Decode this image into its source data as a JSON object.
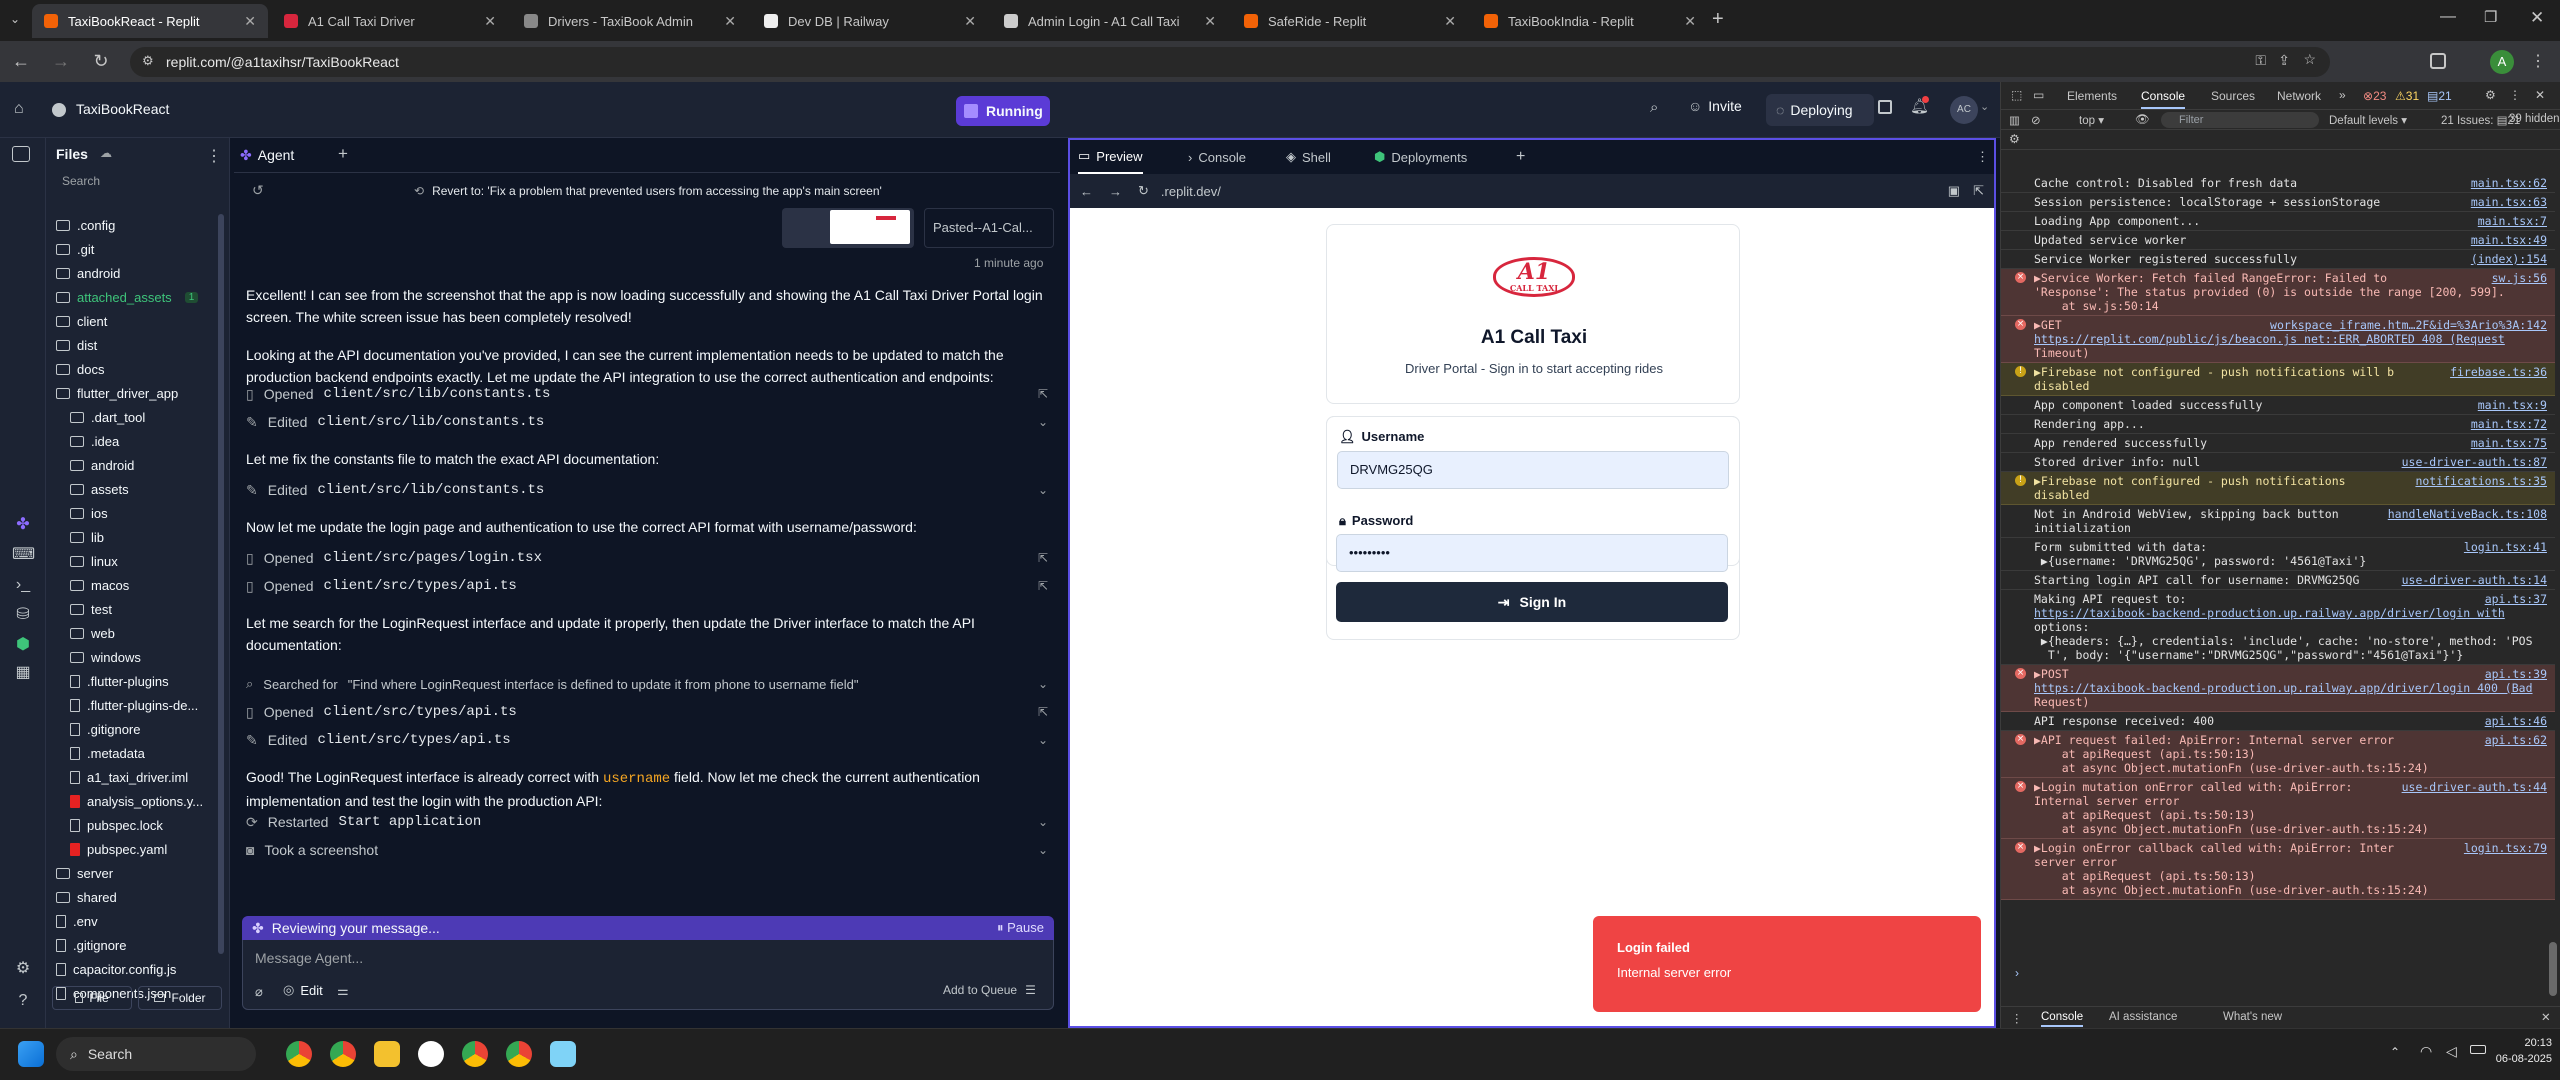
{
  "browser": {
    "tabs": [
      {
        "title": "TaxiBookReact - Replit",
        "color": "#f26207"
      },
      {
        "title": "A1 Call Taxi Driver",
        "color": "#d7263d"
      },
      {
        "title": "Drivers - TaxiBook Admin",
        "color": "#888888"
      },
      {
        "title": "Dev DB | Railway",
        "color": "#eeeeee"
      },
      {
        "title": "Admin Login - A1 Call Taxi",
        "color": "#cccccc"
      },
      {
        "title": "SafeRide - Replit",
        "color": "#f26207"
      },
      {
        "title": "TaxiBookIndia - Replit",
        "color": "#f26207"
      }
    ],
    "url": "replit.com/@a1taxihsr/TaxiBookReact",
    "profile_initial": "A"
  },
  "replit": {
    "project_name": "TaxiBookReact",
    "run_label": "Running",
    "invite_label": "Invite",
    "deploying_label": "Deploying",
    "avatar": "AC",
    "files_title": "Files",
    "search_placeholder": "Search",
    "file_button": "File",
    "folder_button": "Folder",
    "badge_count": "1",
    "files": [
      {
        "name": ".config",
        "kind": "folder",
        "indent": 0
      },
      {
        "name": ".git",
        "kind": "folder",
        "indent": 0
      },
      {
        "name": "android",
        "kind": "folder",
        "indent": 0
      },
      {
        "name": "attached_assets",
        "kind": "folder",
        "indent": 0,
        "highlight": true
      },
      {
        "name": "client",
        "kind": "folder",
        "indent": 0
      },
      {
        "name": "dist",
        "kind": "folder",
        "indent": 0
      },
      {
        "name": "docs",
        "kind": "folder",
        "indent": 0
      },
      {
        "name": "flutter_driver_app",
        "kind": "folder",
        "indent": 0
      },
      {
        "name": ".dart_tool",
        "kind": "folder",
        "indent": 1
      },
      {
        "name": ".idea",
        "kind": "folder",
        "indent": 1
      },
      {
        "name": "android",
        "kind": "folder",
        "indent": 1
      },
      {
        "name": "assets",
        "kind": "folder",
        "indent": 1
      },
      {
        "name": "ios",
        "kind": "folder",
        "indent": 1
      },
      {
        "name": "lib",
        "kind": "folder",
        "indent": 1
      },
      {
        "name": "linux",
        "kind": "folder",
        "indent": 1
      },
      {
        "name": "macos",
        "kind": "folder",
        "indent": 1
      },
      {
        "name": "test",
        "kind": "folder",
        "indent": 1
      },
      {
        "name": "web",
        "kind": "folder",
        "indent": 1
      },
      {
        "name": "windows",
        "kind": "folder",
        "indent": 1
      },
      {
        "name": ".flutter-plugins",
        "kind": "file",
        "indent": 1
      },
      {
        "name": ".flutter-plugins-de...",
        "kind": "file",
        "indent": 1
      },
      {
        "name": ".gitignore",
        "kind": "file",
        "indent": 1
      },
      {
        "name": ".metadata",
        "kind": "file",
        "indent": 1
      },
      {
        "name": "a1_taxi_driver.iml",
        "kind": "file",
        "indent": 1
      },
      {
        "name": "analysis_options.y...",
        "kind": "red",
        "indent": 1
      },
      {
        "name": "pubspec.lock",
        "kind": "file",
        "indent": 1
      },
      {
        "name": "pubspec.yaml",
        "kind": "red",
        "indent": 1
      },
      {
        "name": "server",
        "kind": "folder",
        "indent": 0
      },
      {
        "name": "shared",
        "kind": "folder",
        "indent": 0
      },
      {
        "name": ".env",
        "kind": "file",
        "indent": 0
      },
      {
        "name": ".gitignore",
        "kind": "file",
        "indent": 0
      },
      {
        "name": "capacitor.config.js",
        "kind": "file",
        "indent": 0
      },
      {
        "name": "components.json",
        "kind": "file",
        "indent": 0
      }
    ]
  },
  "agent": {
    "tab_label": "Agent",
    "revert_text": "Revert to: 'Fix a problem that prevented users from accessing the app's main screen'",
    "pasted_label": "Pasted--A1-Cal...",
    "time_ago": "1 minute ago",
    "messages": [
      "Excellent! I can see from the screenshot that the app is now loading successfully and showing the A1 Call Taxi Driver Portal login screen. The white screen issue has been completely resolved!",
      "Looking at the API documentation you've provided, I can see the current implementation needs to be updated to match the production backend endpoints exactly. Let me update the API integration to use the correct authentication and endpoints:",
      "Let me fix the constants file to match the exact API documentation:",
      "Now let me update the login page and authentication to use the correct API format with username/password:",
      "Let me search for the LoginRequest interface and update it properly, then update the Driver interface to match the API documentation:"
    ],
    "msg_good_a": "Good! The LoginRequest interface is already correct with ",
    "msg_good_code": "username",
    "msg_good_b": " field. Now let me check the current authentication implementation and test the login with the production API:",
    "actions": [
      {
        "verb": "Opened",
        "path": "client/src/lib/constants.ts"
      },
      {
        "verb": "Edited",
        "path": "client/src/lib/constants.ts"
      },
      {
        "verb": "Edited",
        "path": "client/src/lib/constants.ts"
      },
      {
        "verb": "Opened",
        "path": "client/src/pages/login.tsx"
      },
      {
        "verb": "Opened",
        "path": "client/src/types/api.ts"
      },
      {
        "verb": "Searched for",
        "path": "\"Find where LoginRequest interface is defined to update it from phone to username field\""
      },
      {
        "verb": "Opened",
        "path": "client/src/types/api.ts"
      },
      {
        "verb": "Edited",
        "path": "client/src/types/api.ts"
      },
      {
        "verb": "Restarted",
        "path": "Start application"
      },
      {
        "verb": "Took a screenshot",
        "path": ""
      }
    ],
    "reviewing": "Reviewing your message...",
    "pause": "Pause",
    "input_placeholder": "Message Agent...",
    "edit_label": "Edit",
    "queue_label": "Add to Queue"
  },
  "preview": {
    "tabs": [
      "Preview",
      "Console",
      "Shell",
      "Deployments"
    ],
    "url": ".replit.dev/",
    "logo_text": "A1",
    "logo_sub": "CALL TAXI",
    "app_title": "A1 Call Taxi",
    "app_subtitle": "Driver Portal - Sign in to start accepting rides",
    "username_label": "Username",
    "username_value": "DRVMG25QG",
    "password_label": "Password",
    "password_value": "•••••••••",
    "signin_label": "Sign In",
    "toast_title": "Login failed",
    "toast_body": "Internal server error"
  },
  "devtools": {
    "tabs": [
      "Elements",
      "Console",
      "Sources",
      "Network"
    ],
    "err_count": "23",
    "warn_count": "31",
    "info_count": "21",
    "context": "top",
    "filter_placeholder": "Filter",
    "levels": "Default levels",
    "issues": "21 Issues:",
    "issues_count": "21",
    "hidden": "39 hidden",
    "bottom_tabs": [
      "Console",
      "AI assistance",
      "What's new"
    ],
    "rows": [
      {
        "type": "log",
        "lines": [
          "Cache control: Disabled for fresh data"
        ],
        "src": "main.tsx:62"
      },
      {
        "type": "log",
        "lines": [
          "Session persistence: localStorage + sessionStorage"
        ],
        "src": "main.tsx:63"
      },
      {
        "type": "log",
        "lines": [
          "Loading App component..."
        ],
        "src": "main.tsx:7"
      },
      {
        "type": "log",
        "lines": [
          "Updated service worker"
        ],
        "src": "main.tsx:49"
      },
      {
        "type": "log",
        "lines": [
          "Service Worker registered successfully"
        ],
        "src": "(index):154"
      },
      {
        "type": "err",
        "lines": [
          "▶Service Worker: Fetch failed RangeError: Failed to construct",
          "'Response': The status provided (0) is outside the range [200, 599].",
          "    at sw.js:50:14"
        ],
        "src": "sw.js:56"
      },
      {
        "type": "err",
        "lines": [
          "▶GET",
          "https://replit.com/public/js/beacon.js net::ERR_ABORTED 408 (Request",
          "Timeout)"
        ],
        "src": "workspace_iframe.htm…2F&id=%3Ario%3A:142"
      },
      {
        "type": "warn",
        "lines": [
          "▶Firebase not configured - push notifications will be",
          "disabled"
        ],
        "src": "firebase.ts:36"
      },
      {
        "type": "log",
        "lines": [
          "App component loaded successfully"
        ],
        "src": "main.tsx:9"
      },
      {
        "type": "log",
        "lines": [
          "Rendering app..."
        ],
        "src": "main.tsx:72"
      },
      {
        "type": "log",
        "lines": [
          "App rendered successfully"
        ],
        "src": "main.tsx:75"
      },
      {
        "type": "log",
        "lines": [
          "Stored driver info: null"
        ],
        "src": "use-driver-auth.ts:87"
      },
      {
        "type": "warn",
        "lines": [
          "▶Firebase not configured - push notifications",
          "disabled"
        ],
        "src": "notifications.ts:35"
      },
      {
        "type": "log",
        "lines": [
          "Not in Android WebView, skipping back button",
          "initialization"
        ],
        "src": "handleNativeBack.ts:108"
      },
      {
        "type": "log",
        "lines": [
          "Form submitted with data:",
          " ▶{username: 'DRVMG25QG', password: '4561@Taxi'}"
        ],
        "src": "login.tsx:41"
      },
      {
        "type": "log",
        "lines": [
          "Starting login API call for username: DRVMG25QG"
        ],
        "src": "use-driver-auth.ts:14"
      },
      {
        "type": "log",
        "lines": [
          "Making API request to:",
          "https://taxibook-backend-production.up.railway.app/driver/login with",
          "options:",
          " ▶{headers: {…}, credentials: 'include', cache: 'no-store', method: 'POS",
          "  T', body: '{\"username\":\"DRVMG25QG\",\"password\":\"4561@Taxi\"}'}"
        ],
        "src": "api.ts:37"
      },
      {
        "type": "err",
        "lines": [
          "▶POST",
          "https://taxibook-backend-production.up.railway.app/driver/login 400 (Bad",
          "Request)"
        ],
        "src": "api.ts:39"
      },
      {
        "type": "log",
        "lines": [
          "API response received: 400"
        ],
        "src": "api.ts:46"
      },
      {
        "type": "err",
        "lines": [
          "▶API request failed: ApiError: Internal server error",
          "    at apiRequest (api.ts:50:13)",
          "    at async Object.mutationFn (use-driver-auth.ts:15:24)"
        ],
        "src": "api.ts:62"
      },
      {
        "type": "err",
        "lines": [
          "▶Login mutation onError called with: ApiError:",
          "Internal server error",
          "    at apiRequest (api.ts:50:13)",
          "    at async Object.mutationFn (use-driver-auth.ts:15:24)"
        ],
        "src": "use-driver-auth.ts:44"
      },
      {
        "type": "err",
        "lines": [
          "▶Login onError callback called with: ApiError: Internal",
          "server error",
          "    at apiRequest (api.ts:50:13)",
          "    at async Object.mutationFn (use-driver-auth.ts:15:24)"
        ],
        "src": "login.tsx:79"
      }
    ]
  },
  "taskbar": {
    "search_label": "Search",
    "time": "20:13",
    "date": "06-08-2025"
  }
}
